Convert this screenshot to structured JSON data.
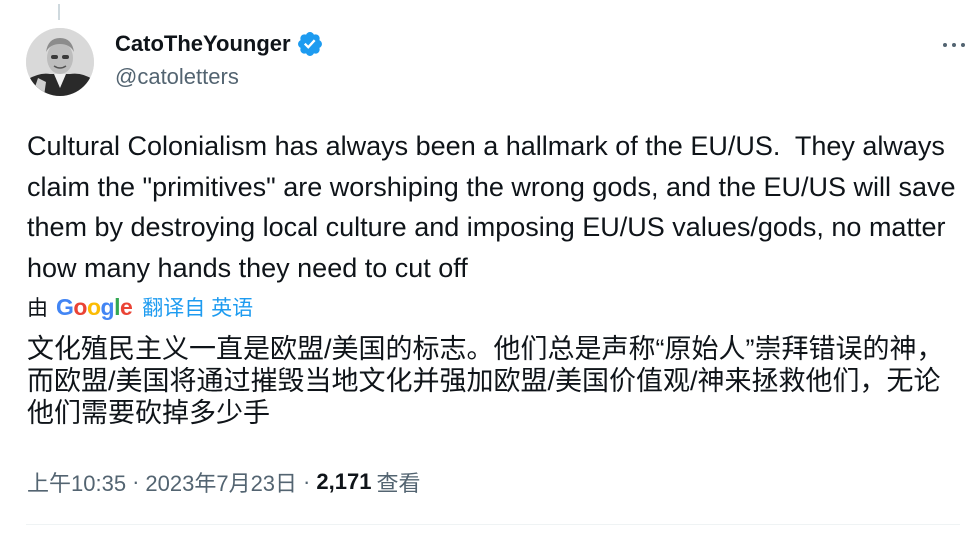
{
  "author": {
    "display_name": "CatoTheYounger",
    "handle": "@catoletters",
    "verified": true,
    "verified_color": "#1d9bf0"
  },
  "tweet": {
    "text": "Cultural Colonialism has always been a hallmark of the EU/US.  They always claim the \"primitives\" are worshiping the wrong gods, and the EU/US will save them by destroying local culture and imposing EU/US values/gods, no matter how many hands they need to cut off"
  },
  "translation": {
    "by_prefix": "由",
    "provider": "Google",
    "link_text": "翻译自 英语",
    "text": "文化殖民主义一直是欧盟/美国的标志。他们总是声称“原始人”崇拜错误的神，而欧盟/美国将通过摧毁当地文化并强加欧盟/美国价值观/神来拯救他们，无论他们需要砍掉多少手"
  },
  "meta": {
    "time": "上午10:35",
    "separator": "·",
    "date": "2023年7月23日",
    "views_count": "2,171",
    "views_label": "查看"
  },
  "icons": {
    "verified": "verified-badge-icon",
    "more": "more-options-icon"
  },
  "colors": {
    "link": "#1d9bf0",
    "secondary_text": "#536471",
    "primary_text": "#0f1419"
  }
}
